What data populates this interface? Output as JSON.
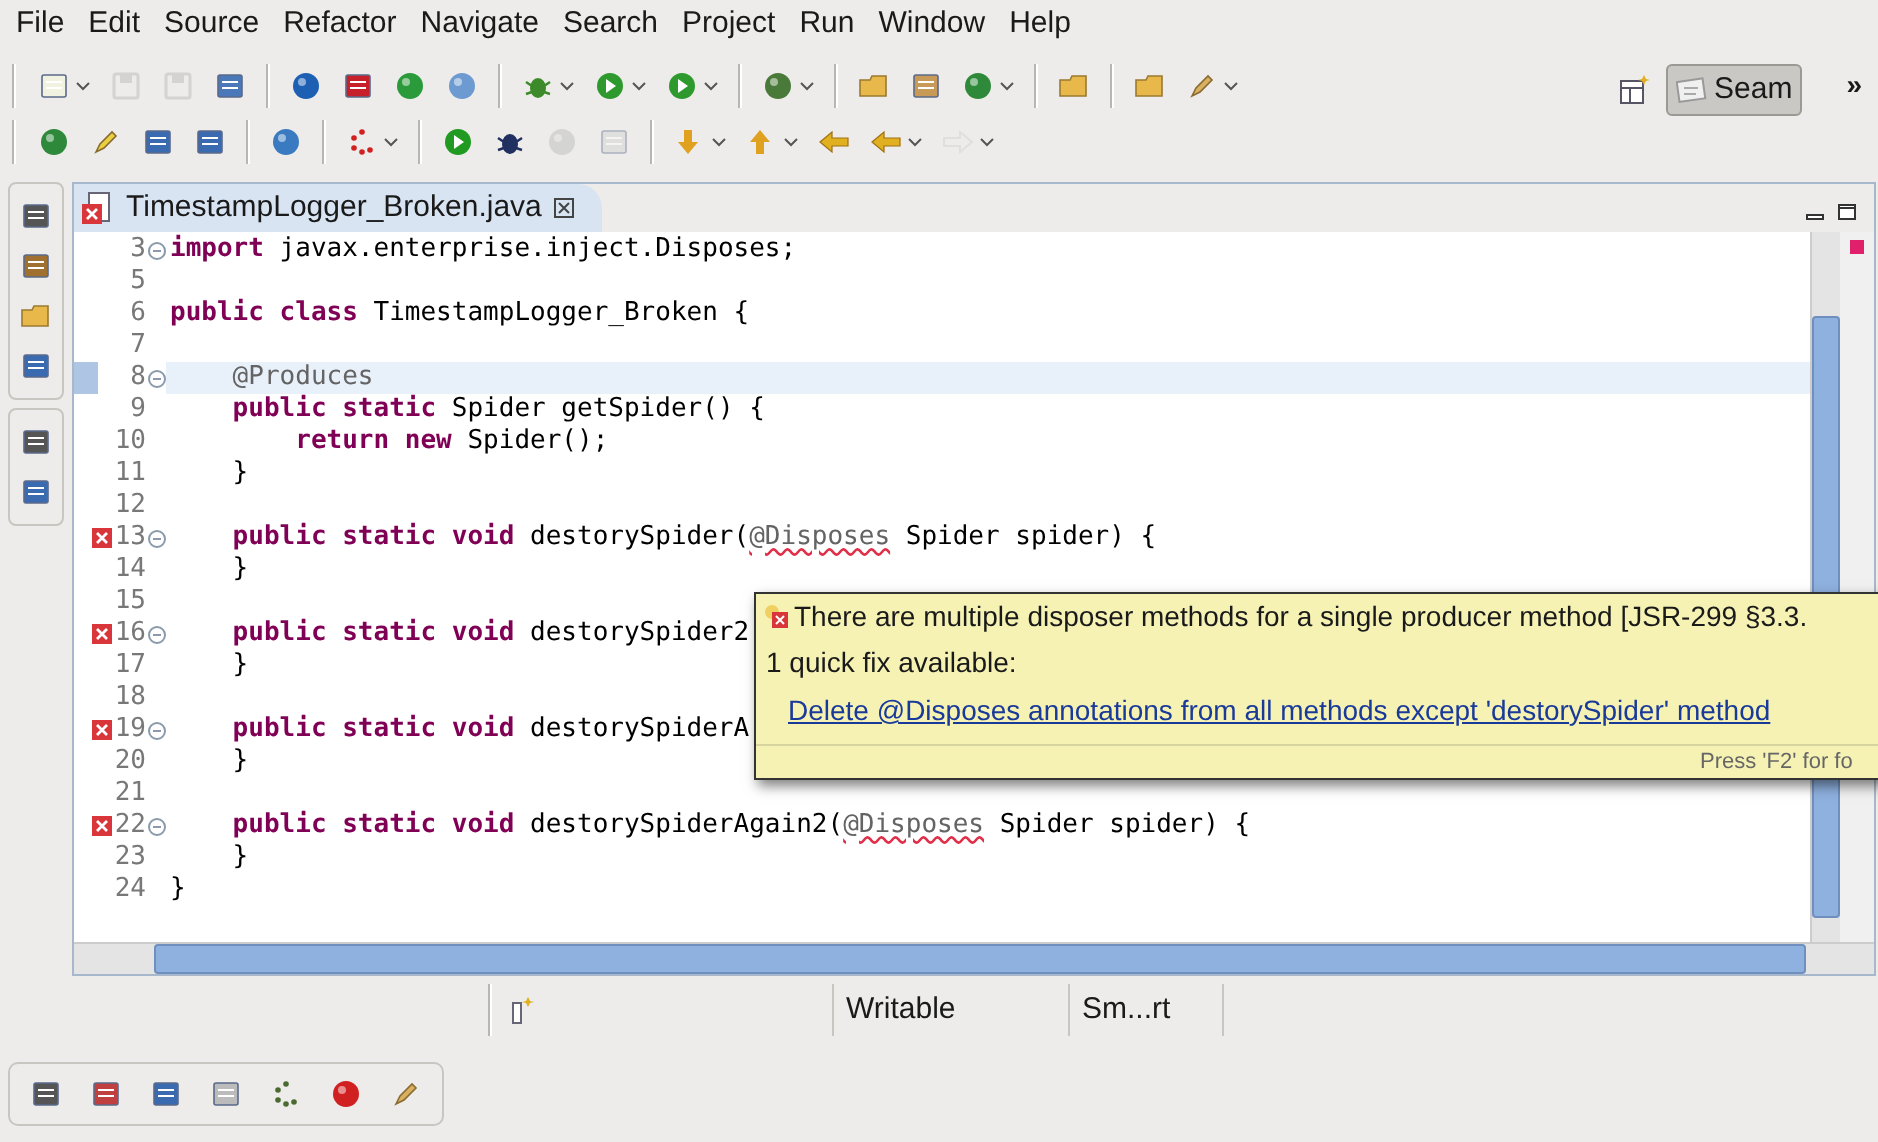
{
  "menu_bar": [
    "File",
    "Edit",
    "Source",
    "Refactor",
    "Navigate",
    "Search",
    "Project",
    "Run",
    "Window",
    "Help"
  ],
  "toolbar_rows": [
    [
      {
        "kind": "button",
        "disabled": false,
        "menu": true
      },
      {
        "kind": "button",
        "disabled": true,
        "menu": false
      },
      {
        "kind": "button",
        "disabled": true,
        "menu": false
      },
      {
        "kind": "button",
        "disabled": false,
        "menu": false
      },
      {
        "kind": "separator"
      },
      {
        "kind": "button",
        "disabled": false,
        "menu": false
      },
      {
        "kind": "button",
        "disabled": false,
        "menu": false
      },
      {
        "kind": "button",
        "disabled": false,
        "menu": false
      },
      {
        "kind": "button",
        "disabled": false,
        "menu": false
      },
      {
        "kind": "separator"
      },
      {
        "kind": "button",
        "disabled": false,
        "menu": true
      },
      {
        "kind": "button",
        "disabled": false,
        "menu": true
      },
      {
        "kind": "button",
        "disabled": false,
        "menu": true
      },
      {
        "kind": "separator"
      },
      {
        "kind": "button",
        "disabled": false,
        "menu": true
      },
      {
        "kind": "separator"
      },
      {
        "kind": "button",
        "disabled": false,
        "menu": false
      },
      {
        "kind": "button",
        "disabled": false,
        "menu": false
      },
      {
        "kind": "button",
        "disabled": false,
        "menu": true
      },
      {
        "kind": "separator"
      },
      {
        "kind": "button",
        "disabled": false,
        "menu": false
      },
      {
        "kind": "separator"
      },
      {
        "kind": "button",
        "disabled": false,
        "menu": false
      },
      {
        "kind": "button",
        "disabled": false,
        "menu": true
      }
    ],
    [
      {
        "kind": "button",
        "disabled": false,
        "menu": false
      },
      {
        "kind": "button",
        "disabled": false,
        "menu": false
      },
      {
        "kind": "button",
        "disabled": false,
        "menu": false
      },
      {
        "kind": "button",
        "disabled": false,
        "menu": false
      },
      {
        "kind": "separator"
      },
      {
        "kind": "button",
        "disabled": false,
        "menu": false
      },
      {
        "kind": "separator"
      },
      {
        "kind": "button",
        "disabled": false,
        "menu": true
      },
      {
        "kind": "separator"
      },
      {
        "kind": "button",
        "disabled": false,
        "menu": false
      },
      {
        "kind": "button",
        "disabled": false,
        "menu": false
      },
      {
        "kind": "button",
        "disabled": true,
        "menu": false
      },
      {
        "kind": "button",
        "disabled": true,
        "menu": false
      },
      {
        "kind": "separator"
      },
      {
        "kind": "button",
        "disabled": false,
        "menu": true
      },
      {
        "kind": "button",
        "disabled": false,
        "menu": true
      },
      {
        "kind": "button",
        "disabled": false,
        "menu": false
      },
      {
        "kind": "button",
        "disabled": false,
        "menu": true
      },
      {
        "kind": "button",
        "disabled": true,
        "menu": true
      }
    ]
  ],
  "perspective": {
    "label": "Seam",
    "selected": true
  },
  "more_toolbar": "»",
  "editor": {
    "tab": {
      "title": "TimestampLogger_Broken.java",
      "error": true
    },
    "lines": [
      {
        "number": "3",
        "error": false,
        "fold": true,
        "highlighted": false,
        "tokens": [
          {
            "text": "import ",
            "kind": "keyword"
          },
          {
            "text": "javax.enterprise.inject.Disposes;",
            "kind": "plain"
          }
        ]
      },
      {
        "number": "5",
        "error": false,
        "fold": false,
        "highlighted": false
      },
      {
        "number": "6",
        "error": false,
        "fold": false,
        "highlighted": false,
        "tokens": [
          {
            "text": "public class ",
            "kind": "keyword"
          },
          {
            "text": "TimestampLogger_Broken {",
            "kind": "plain"
          }
        ]
      },
      {
        "number": "7",
        "error": false,
        "fold": false,
        "highlighted": false
      },
      {
        "number": "8",
        "error": false,
        "fold": true,
        "highlighted": true,
        "tokens": [
          {
            "text": "    @Produces",
            "kind": "annotation"
          }
        ]
      },
      {
        "number": "9",
        "error": false,
        "fold": false,
        "highlighted": false,
        "tokens": [
          {
            "text": "    public static ",
            "kind": "keyword"
          },
          {
            "text": "Spider getSpider() {",
            "kind": "plain"
          }
        ]
      },
      {
        "number": "10",
        "error": false,
        "fold": false,
        "highlighted": false,
        "tokens": [
          {
            "text": "        return new ",
            "kind": "keyword"
          },
          {
            "text": "Spider();",
            "kind": "plain"
          }
        ]
      },
      {
        "number": "11",
        "error": false,
        "fold": false,
        "highlighted": false,
        "tokens": [
          {
            "text": "    }",
            "kind": "plain"
          }
        ]
      },
      {
        "number": "12",
        "error": false,
        "fold": false,
        "highlighted": false
      },
      {
        "number": "13",
        "error": true,
        "fold": true,
        "highlighted": false,
        "tokens": [
          {
            "text": "    public static void ",
            "kind": "keyword"
          },
          {
            "text": "destorySpider(",
            "kind": "plain"
          },
          {
            "text": "@Disposes",
            "kind": "annotation_error"
          },
          {
            "text": " Spider spider) {",
            "kind": "plain"
          }
        ]
      },
      {
        "number": "14",
        "error": false,
        "fold": false,
        "highlighted": false,
        "tokens": [
          {
            "text": "    }",
            "kind": "plain"
          }
        ]
      },
      {
        "number": "15",
        "error": false,
        "fold": false,
        "highlighted": false
      },
      {
        "number": "16",
        "error": true,
        "fold": true,
        "highlighted": false,
        "tokens": [
          {
            "text": "    public static void ",
            "kind": "keyword"
          },
          {
            "text": "destorySpider2",
            "kind": "plain"
          }
        ]
      },
      {
        "number": "17",
        "error": false,
        "fold": false,
        "highlighted": false,
        "tokens": [
          {
            "text": "    }",
            "kind": "plain"
          }
        ]
      },
      {
        "number": "18",
        "error": false,
        "fold": false,
        "highlighted": false
      },
      {
        "number": "19",
        "error": true,
        "fold": true,
        "highlighted": false,
        "tokens": [
          {
            "text": "    public static void ",
            "kind": "keyword"
          },
          {
            "text": "destorySpiderA",
            "kind": "plain"
          }
        ]
      },
      {
        "number": "20",
        "error": false,
        "fold": false,
        "highlighted": false,
        "tokens": [
          {
            "text": "    }",
            "kind": "plain"
          }
        ]
      },
      {
        "number": "21",
        "error": false,
        "fold": false,
        "highlighted": false
      },
      {
        "number": "22",
        "error": true,
        "fold": true,
        "highlighted": false,
        "tokens": [
          {
            "text": "    public static void ",
            "kind": "keyword"
          },
          {
            "text": "destorySpiderAgain2(",
            "kind": "plain"
          },
          {
            "text": "@Disposes",
            "kind": "annotation_error"
          },
          {
            "text": " Spider spider) {",
            "kind": "plain"
          }
        ]
      },
      {
        "number": "23",
        "error": false,
        "fold": false,
        "highlighted": false,
        "tokens": [
          {
            "text": "    }",
            "kind": "plain"
          }
        ]
      },
      {
        "number": "24",
        "error": false,
        "fold": false,
        "highlighted": false,
        "tokens": [
          {
            "text": "}",
            "kind": "plain"
          }
        ]
      }
    ]
  },
  "hover": {
    "message": "There are multiple disposer methods for a single producer method [JSR-299 §3.3.",
    "quick_fix_count": "1 quick fix available:",
    "fix": "Delete @Disposes annotations from all methods except 'destorySpider' method",
    "footer": "Press 'F2' for fo"
  },
  "status_bar": [
    "Writable",
    "Sm...rt"
  ]
}
